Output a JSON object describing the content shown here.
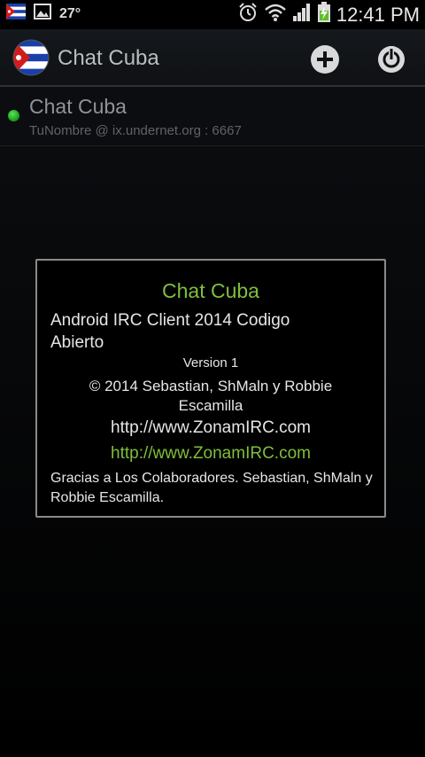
{
  "status_bar": {
    "temperature": "27°",
    "time": "12:41 PM",
    "icons": [
      "cuba-flag-icon",
      "image-icon",
      "alarm-icon",
      "wifi-icon",
      "signal-icon",
      "battery-charging-icon"
    ]
  },
  "action_bar": {
    "title": "Chat Cuba",
    "add_icon": "add-server-icon",
    "power_icon": "power-icon"
  },
  "server": {
    "name": "Chat Cuba",
    "host": "TuNombre @ ix.undernet.org : 6667",
    "status_color": "#2ec22e"
  },
  "about_dialog": {
    "title": "Chat Cuba",
    "subtitle": "Android IRC Client 2014 Codigo Abierto",
    "version": "Version 1",
    "copyright": "© 2014 Sebastian, ShMaln y Robbie Escamilla",
    "url_plain": "http://www.ZonamIRC.com",
    "url_link": "http://www.ZonamIRC.com",
    "thanks": "Gracias a Los Colaboradores. Sebastian, ShMaln y Robbie Escamilla."
  },
  "colors": {
    "accent_green": "#7fbf3a",
    "background": "#0b0d10"
  }
}
